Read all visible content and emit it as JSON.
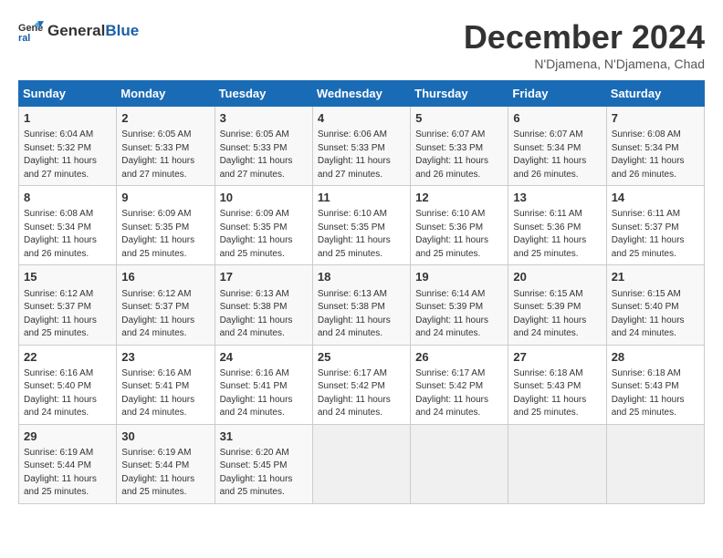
{
  "logo": {
    "general": "General",
    "blue": "Blue"
  },
  "title": "December 2024",
  "location": "N'Djamena, N'Djamena, Chad",
  "days_of_week": [
    "Sunday",
    "Monday",
    "Tuesday",
    "Wednesday",
    "Thursday",
    "Friday",
    "Saturday"
  ],
  "weeks": [
    [
      {
        "day": "1",
        "info": "Sunrise: 6:04 AM\nSunset: 5:32 PM\nDaylight: 11 hours\nand 27 minutes."
      },
      {
        "day": "2",
        "info": "Sunrise: 6:05 AM\nSunset: 5:33 PM\nDaylight: 11 hours\nand 27 minutes."
      },
      {
        "day": "3",
        "info": "Sunrise: 6:05 AM\nSunset: 5:33 PM\nDaylight: 11 hours\nand 27 minutes."
      },
      {
        "day": "4",
        "info": "Sunrise: 6:06 AM\nSunset: 5:33 PM\nDaylight: 11 hours\nand 27 minutes."
      },
      {
        "day": "5",
        "info": "Sunrise: 6:07 AM\nSunset: 5:33 PM\nDaylight: 11 hours\nand 26 minutes."
      },
      {
        "day": "6",
        "info": "Sunrise: 6:07 AM\nSunset: 5:34 PM\nDaylight: 11 hours\nand 26 minutes."
      },
      {
        "day": "7",
        "info": "Sunrise: 6:08 AM\nSunset: 5:34 PM\nDaylight: 11 hours\nand 26 minutes."
      }
    ],
    [
      {
        "day": "8",
        "info": "Sunrise: 6:08 AM\nSunset: 5:34 PM\nDaylight: 11 hours\nand 26 minutes."
      },
      {
        "day": "9",
        "info": "Sunrise: 6:09 AM\nSunset: 5:35 PM\nDaylight: 11 hours\nand 25 minutes."
      },
      {
        "day": "10",
        "info": "Sunrise: 6:09 AM\nSunset: 5:35 PM\nDaylight: 11 hours\nand 25 minutes."
      },
      {
        "day": "11",
        "info": "Sunrise: 6:10 AM\nSunset: 5:35 PM\nDaylight: 11 hours\nand 25 minutes."
      },
      {
        "day": "12",
        "info": "Sunrise: 6:10 AM\nSunset: 5:36 PM\nDaylight: 11 hours\nand 25 minutes."
      },
      {
        "day": "13",
        "info": "Sunrise: 6:11 AM\nSunset: 5:36 PM\nDaylight: 11 hours\nand 25 minutes."
      },
      {
        "day": "14",
        "info": "Sunrise: 6:11 AM\nSunset: 5:37 PM\nDaylight: 11 hours\nand 25 minutes."
      }
    ],
    [
      {
        "day": "15",
        "info": "Sunrise: 6:12 AM\nSunset: 5:37 PM\nDaylight: 11 hours\nand 25 minutes."
      },
      {
        "day": "16",
        "info": "Sunrise: 6:12 AM\nSunset: 5:37 PM\nDaylight: 11 hours\nand 24 minutes."
      },
      {
        "day": "17",
        "info": "Sunrise: 6:13 AM\nSunset: 5:38 PM\nDaylight: 11 hours\nand 24 minutes."
      },
      {
        "day": "18",
        "info": "Sunrise: 6:13 AM\nSunset: 5:38 PM\nDaylight: 11 hours\nand 24 minutes."
      },
      {
        "day": "19",
        "info": "Sunrise: 6:14 AM\nSunset: 5:39 PM\nDaylight: 11 hours\nand 24 minutes."
      },
      {
        "day": "20",
        "info": "Sunrise: 6:15 AM\nSunset: 5:39 PM\nDaylight: 11 hours\nand 24 minutes."
      },
      {
        "day": "21",
        "info": "Sunrise: 6:15 AM\nSunset: 5:40 PM\nDaylight: 11 hours\nand 24 minutes."
      }
    ],
    [
      {
        "day": "22",
        "info": "Sunrise: 6:16 AM\nSunset: 5:40 PM\nDaylight: 11 hours\nand 24 minutes."
      },
      {
        "day": "23",
        "info": "Sunrise: 6:16 AM\nSunset: 5:41 PM\nDaylight: 11 hours\nand 24 minutes."
      },
      {
        "day": "24",
        "info": "Sunrise: 6:16 AM\nSunset: 5:41 PM\nDaylight: 11 hours\nand 24 minutes."
      },
      {
        "day": "25",
        "info": "Sunrise: 6:17 AM\nSunset: 5:42 PM\nDaylight: 11 hours\nand 24 minutes."
      },
      {
        "day": "26",
        "info": "Sunrise: 6:17 AM\nSunset: 5:42 PM\nDaylight: 11 hours\nand 24 minutes."
      },
      {
        "day": "27",
        "info": "Sunrise: 6:18 AM\nSunset: 5:43 PM\nDaylight: 11 hours\nand 25 minutes."
      },
      {
        "day": "28",
        "info": "Sunrise: 6:18 AM\nSunset: 5:43 PM\nDaylight: 11 hours\nand 25 minutes."
      }
    ],
    [
      {
        "day": "29",
        "info": "Sunrise: 6:19 AM\nSunset: 5:44 PM\nDaylight: 11 hours\nand 25 minutes."
      },
      {
        "day": "30",
        "info": "Sunrise: 6:19 AM\nSunset: 5:44 PM\nDaylight: 11 hours\nand 25 minutes."
      },
      {
        "day": "31",
        "info": "Sunrise: 6:20 AM\nSunset: 5:45 PM\nDaylight: 11 hours\nand 25 minutes."
      },
      null,
      null,
      null,
      null
    ]
  ]
}
